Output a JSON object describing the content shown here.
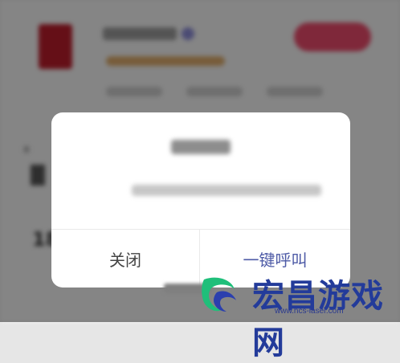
{
  "background": {
    "partial_number": "18"
  },
  "dialog": {
    "close_label": "关闭",
    "call_label": "一键呼叫"
  },
  "watermark": {
    "title": "宏昌游戏网",
    "url": "www.hcs-laser.com"
  },
  "colors": {
    "call_button": "#4d5aa6",
    "watermark_blue": "#233b9a",
    "watermark_green": "#1fbf7a"
  }
}
